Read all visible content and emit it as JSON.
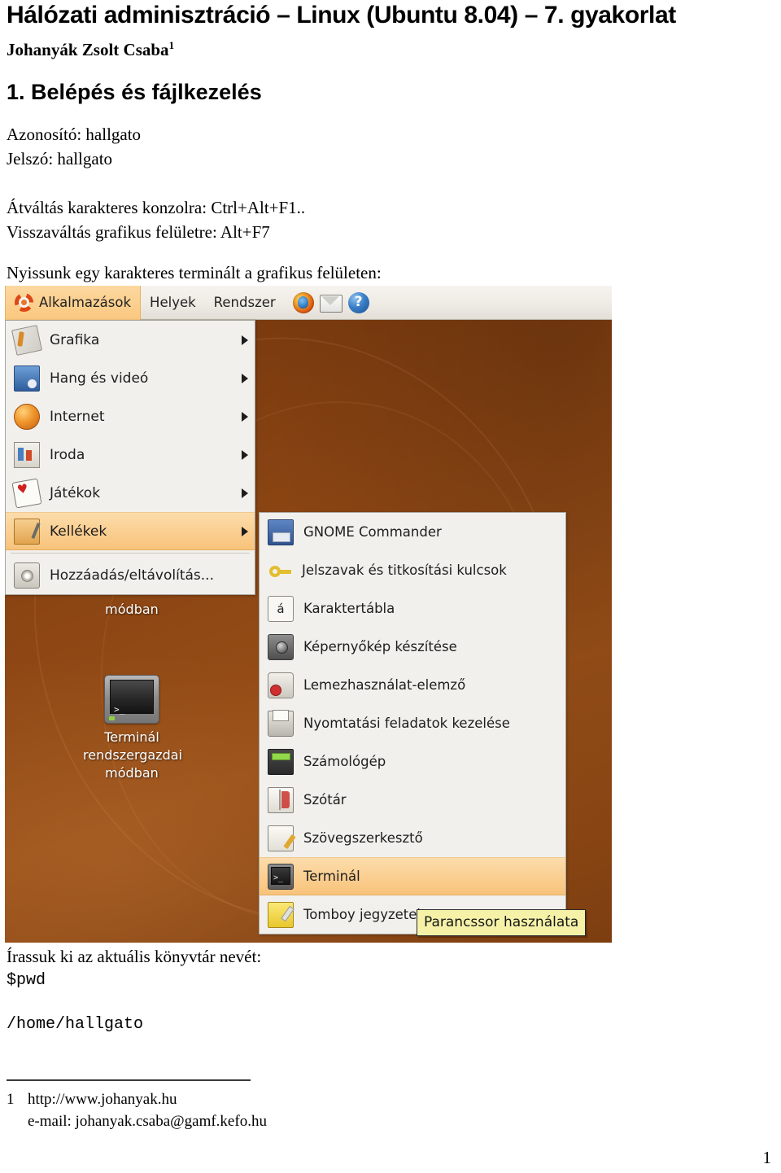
{
  "document": {
    "title": "Hálózati adminisztráció – Linux (Ubuntu 8.04) – 7. gyakorlat",
    "author": "Johanyák Zsolt Csaba",
    "author_footnote_marker": "1",
    "section_heading": "1. Belépés és fájlkezelés",
    "lines": {
      "login_id": "Azonosító: hallgato",
      "password": "Jelszó: hallgato",
      "switch_console": "Átváltás karakteres konzolra: Ctrl+Alt+F1..",
      "switch_back": "Visszaváltás grafikus felületre: Alt+F7",
      "open_terminal": "Nyissunk egy karakteres terminált a grafikus felületen:",
      "print_cwd": "Írassuk ki az aktuális könyvtár nevét:",
      "cmd_pwd": "$pwd",
      "cmd_output": "/home/hallgato"
    },
    "footnote": {
      "number": "1",
      "url": "http://www.johanyak.hu",
      "email": "e-mail: johanyak.csaba@gamf.kefo.hu"
    },
    "page_number": "1"
  },
  "screenshot": {
    "panel": {
      "menus": [
        {
          "label": "Alkalmazások",
          "icon": "ubuntu-logo-icon",
          "active": true
        },
        {
          "label": "Helyek",
          "icon": null,
          "active": false
        },
        {
          "label": "Rendszer",
          "icon": null,
          "active": false
        }
      ],
      "launchers": [
        {
          "name": "firefox-icon"
        },
        {
          "name": "mail-icon"
        },
        {
          "name": "help-icon",
          "glyph": "?"
        }
      ]
    },
    "applications_menu": [
      {
        "label": "Grafika",
        "icon": "graphics-icon",
        "submenu": true,
        "selected": false
      },
      {
        "label": "Hang és videó",
        "icon": "sound-video-icon",
        "submenu": true,
        "selected": false
      },
      {
        "label": "Internet",
        "icon": "internet-icon",
        "submenu": true,
        "selected": false
      },
      {
        "label": "Iroda",
        "icon": "office-icon",
        "submenu": true,
        "selected": false
      },
      {
        "label": "Játékok",
        "icon": "games-icon",
        "submenu": true,
        "selected": false
      },
      {
        "label": "Kellékek",
        "icon": "accessories-icon",
        "submenu": true,
        "selected": true
      },
      {
        "label": "Hozzáadás/eltávolítás...",
        "icon": "add-remove-icon",
        "submenu": false,
        "selected": false
      }
    ],
    "accessories_submenu": [
      {
        "label": "GNOME Commander",
        "icon": "gnome-commander-icon",
        "selected": false
      },
      {
        "label": "Jelszavak és titkosítási kulcsok",
        "icon": "passwords-keys-icon",
        "selected": false
      },
      {
        "label": "Karaktertábla",
        "icon": "character-map-icon",
        "glyph": "á",
        "selected": false
      },
      {
        "label": "Képernyőkép készítése",
        "icon": "screenshot-icon",
        "selected": false
      },
      {
        "label": "Lemezhasználat-elemző",
        "icon": "disk-usage-icon",
        "selected": false
      },
      {
        "label": "Nyomtatási feladatok kezelése",
        "icon": "print-jobs-icon",
        "selected": false
      },
      {
        "label": "Számológép",
        "icon": "calculator-icon",
        "selected": false
      },
      {
        "label": "Szótár",
        "icon": "dictionary-icon",
        "selected": false
      },
      {
        "label": "Szövegszerkesztő",
        "icon": "text-editor-icon",
        "selected": false
      },
      {
        "label": "Terminál",
        "icon": "terminal-icon",
        "selected": true
      },
      {
        "label": "Tomboy jegyzetek",
        "icon": "tomboy-icon",
        "selected": false
      }
    ],
    "tooltip": "Parancssor használata",
    "desktop_icons": [
      {
        "label_top": "módban"
      },
      {
        "label": "Terminál\nrendszergazdai\nmódban",
        "icon": "terminal-root-icon"
      }
    ],
    "desktop_icon_label_line1": "Terminál",
    "desktop_icon_label_line2": "rendszergazdai",
    "desktop_icon_label_line3": "módban",
    "desktop_label_modban": "módban",
    "colors": {
      "desktop_brown": "#8a4413",
      "panel_bg": "#efece6",
      "menu_bg": "#f2f0ec",
      "highlight": "#f8c37a",
      "tooltip_bg": "#f5f2a8",
      "ubuntu_orange": "#dd4814"
    }
  }
}
